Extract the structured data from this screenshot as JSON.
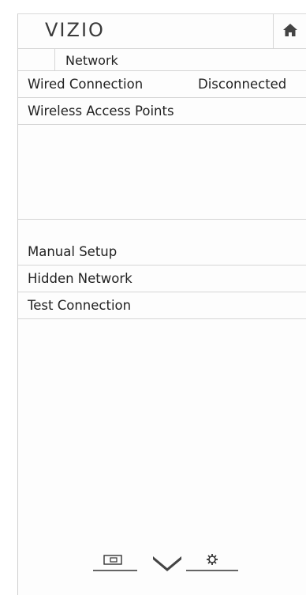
{
  "header": {
    "logo": "VIZIO",
    "home_icon": "home-icon"
  },
  "breadcrumb": {
    "title": "Network"
  },
  "menu": {
    "wired": {
      "label": "Wired Connection",
      "value": "Disconnected"
    },
    "wireless": {
      "label": "Wireless Access Points"
    },
    "manual": {
      "label": "Manual Setup"
    },
    "hidden": {
      "label": "Hidden Network"
    },
    "test": {
      "label": "Test Connection"
    }
  },
  "footer": {
    "icons": [
      "picture-icon",
      "chevron-down-icon",
      "settings-gear-icon"
    ]
  },
  "colors": {
    "background": "#fdfdfd",
    "divider": "#d5d5d5",
    "text": "#222222"
  }
}
